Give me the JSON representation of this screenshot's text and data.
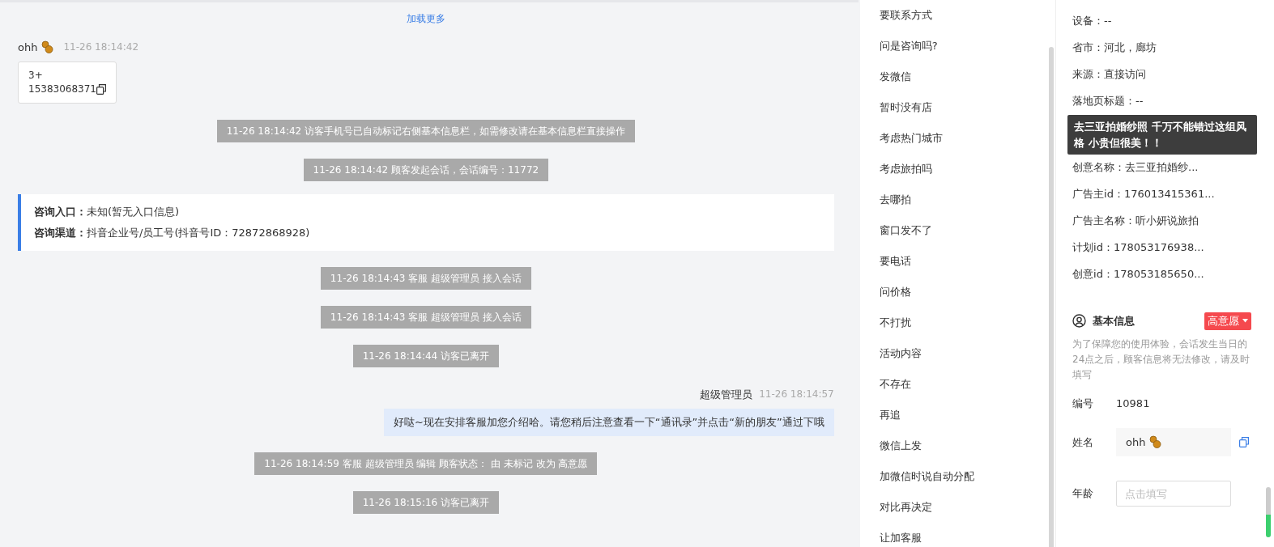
{
  "chat": {
    "load_more": "加载更多",
    "messages": [
      {
        "kind": "visitor",
        "sender": "ohh",
        "time": "11-26 18:14:42",
        "lines": [
          "3+",
          "15383068371"
        ]
      },
      {
        "kind": "system",
        "text": "11-26 18:14:42 访客手机号已自动标记右侧基本信息栏，如需修改请在基本信息栏直接操作"
      },
      {
        "kind": "system",
        "text": "11-26 18:14:42 顾客发起会话，会话编号：11772"
      },
      {
        "kind": "source",
        "rows": [
          "**咨询入口：**未知(暂无入口信息)",
          "**咨询渠道：**抖音企业号/员工号(抖音号ID：72872868928)"
        ]
      },
      {
        "kind": "system",
        "text": "11-26 18:14:43 客服 超级管理员 接入会话"
      },
      {
        "kind": "system",
        "text": "11-26 18:14:43 客服 超级管理员 接入会话"
      },
      {
        "kind": "system",
        "text": "11-26 18:14:44 访客已离开"
      },
      {
        "kind": "agent",
        "sender": "超级管理员",
        "time": "11-26 18:14:57",
        "text": "好哒~现在安排客服加您介绍哈。请您稍后注意查看一下“通讯录”并点击“新的朋友”通过下哦"
      },
      {
        "kind": "system",
        "text": "11-26 18:14:59 客服 超级管理员 编辑 顾客状态： 由 未标记 改为 高意愿"
      },
      {
        "kind": "system",
        "text": "11-26 18:15:16 访客已离开"
      }
    ]
  },
  "quick_replies": [
    "要联系方式",
    "问是咨询吗?",
    "发微信",
    "暂时没有店",
    "考虑热门城市",
    "考虑旅拍吗",
    "去哪拍",
    "窗口发不了",
    "要电话",
    "问价格",
    "不打扰",
    "活动内容",
    "不存在",
    "再追",
    "微信上发",
    "加微信时说自动分配",
    "对比再决定",
    "让加客服"
  ],
  "visitor_info": {
    "items": [
      {
        "kind": "row",
        "text": "设备：--"
      },
      {
        "kind": "row",
        "text": "省市：河北，廊坊"
      },
      {
        "kind": "row",
        "text": "来源：直接访问"
      },
      {
        "kind": "row",
        "text": "落地页标题：--"
      },
      {
        "kind": "tooltip",
        "text": "去三亚拍婚纱照 千万不能错过这组风格 小贵但很美！！"
      },
      {
        "kind": "row",
        "text": "创意名称：去三亚拍婚纱..."
      },
      {
        "kind": "row",
        "text": "广告主id：176013415361..."
      },
      {
        "kind": "row",
        "text": "广告主名称：听小妍说旅拍"
      },
      {
        "kind": "row",
        "text": "计划id：178053176938..."
      },
      {
        "kind": "row",
        "text": "创意id：178053185650..."
      }
    ]
  },
  "basic_info": {
    "title": "基本信息",
    "intent": "高意愿",
    "note": "为了保障您的使用体验，会话发生当日的24点之后，顾客信息将无法修改，请及时填写",
    "fields": [
      {
        "kind": "text",
        "label": "编号",
        "value": "10981"
      },
      {
        "kind": "name",
        "label": "姓名",
        "value": "ohh"
      },
      {
        "kind": "input",
        "label": "年龄",
        "placeholder": "点击填写"
      }
    ]
  }
}
